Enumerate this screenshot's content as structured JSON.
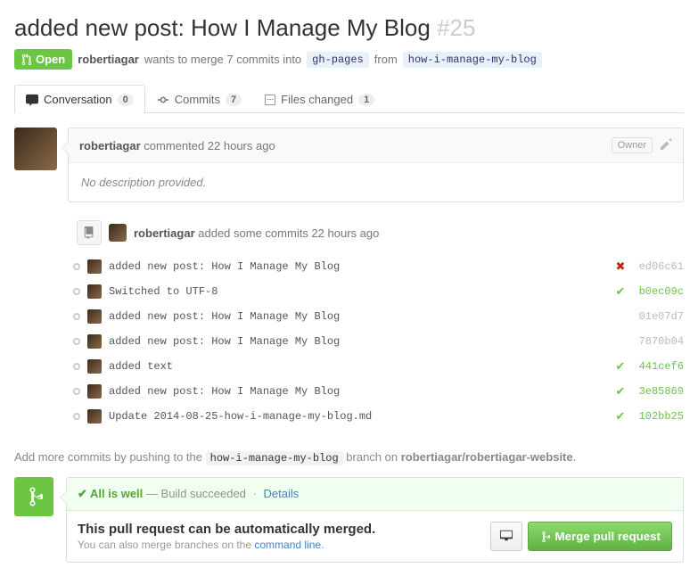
{
  "title": "added new post: How I Manage My Blog",
  "number": "#25",
  "state": "Open",
  "author": "robertiagar",
  "merge_line": {
    "p1": "wants to merge 7 commits into",
    "base": "gh-pages",
    "p2": "from",
    "head": "how-i-manage-my-blog"
  },
  "tabs": {
    "conversation": {
      "label": "Conversation",
      "count": "0"
    },
    "commits": {
      "label": "Commits",
      "count": "7"
    },
    "files": {
      "label": "Files changed",
      "count": "1"
    }
  },
  "comment": {
    "author": "robertiagar",
    "meta": "commented 22 hours ago",
    "owner": "Owner",
    "body": "No description provided."
  },
  "event": {
    "author": "robertiagar",
    "text": "added some commits 22 hours ago"
  },
  "commits_list": [
    {
      "msg": "added new post: How I Manage My Blog",
      "status": "fail",
      "sha": "ed06c61"
    },
    {
      "msg": "Switched to UTF-8",
      "status": "ok",
      "sha": "b0ec09c"
    },
    {
      "msg": "added new post: How I Manage My Blog",
      "status": "none",
      "sha": "01e07d7"
    },
    {
      "msg": "added new post: How I Manage My Blog",
      "status": "none",
      "sha": "7870b04"
    },
    {
      "msg": "added text",
      "status": "ok",
      "sha": "441cef6"
    },
    {
      "msg": "added new post: How I Manage My Blog",
      "status": "ok",
      "sha": "3e85869"
    },
    {
      "msg": "Update 2014-08-25-how-i-manage-my-blog.md",
      "status": "ok",
      "sha": "102bb25"
    }
  ],
  "push_hint": {
    "p1": "Add more commits by pushing to the",
    "branch": "how-i-manage-my-blog",
    "p2": "branch on",
    "repo": "robertiagar/robertiagar-website",
    "p3": "."
  },
  "merge": {
    "status_strong": "All is well",
    "status_rest": "— Build succeeded",
    "details": "Details",
    "headline": "This pull request can be automatically merged.",
    "sub1": "You can also merge branches on the ",
    "cli": "command line",
    "sub2": ".",
    "button": "Merge pull request"
  }
}
